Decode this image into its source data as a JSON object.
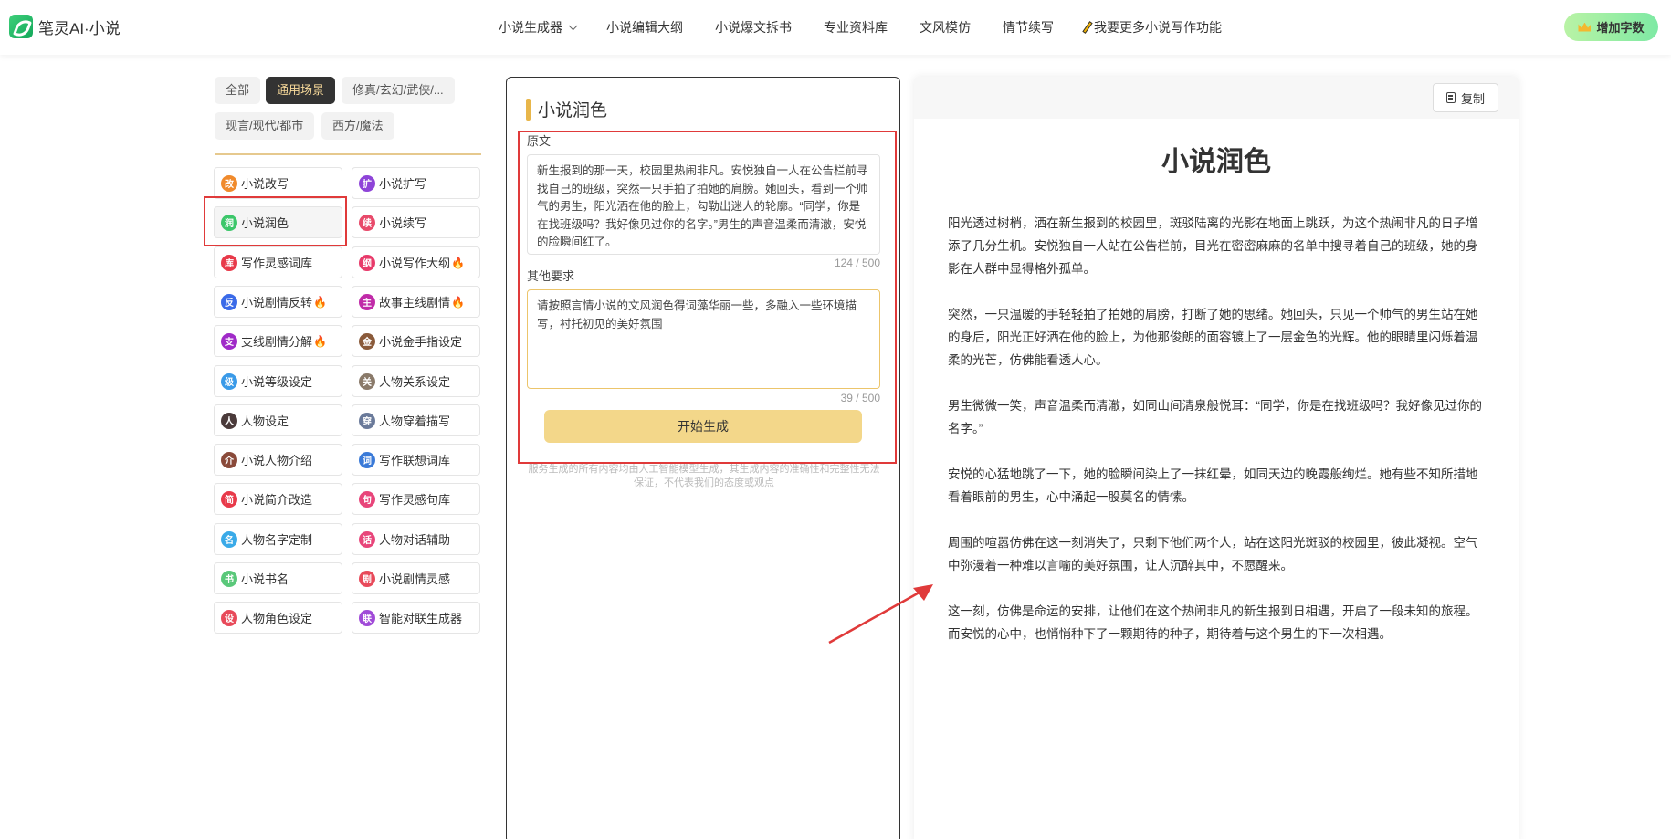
{
  "header": {
    "logo_text": "笔灵AI·小说",
    "nav": [
      {
        "label": "小说生成器",
        "has_dropdown": true
      },
      {
        "label": "小说编辑大纲"
      },
      {
        "label": "小说爆文拆书"
      },
      {
        "label": "专业资料库"
      },
      {
        "label": "文风模仿"
      },
      {
        "label": "情节续写"
      },
      {
        "label": "我要更多小说写作功能",
        "icon": "pencil-icon"
      }
    ],
    "add_words_label": "增加字数"
  },
  "left": {
    "tabs": [
      "全部",
      "通用场景",
      "修真/玄幻/武侠/...",
      "现言/现代/都市",
      "西方/魔法"
    ],
    "active_tab": "通用场景",
    "tools": [
      {
        "label": "小说改写",
        "icon_text": "改",
        "color": "#f08a2c"
      },
      {
        "label": "小说扩写",
        "icon_text": "扩",
        "color": "#8e44d8"
      },
      {
        "label": "小说润色",
        "icon_text": "润",
        "color": "#3cc76a",
        "selected": true
      },
      {
        "label": "小说续写",
        "icon_text": "续",
        "color": "#e84a6a"
      },
      {
        "label": "写作灵感词库",
        "icon_text": "库",
        "color": "#e83a4a"
      },
      {
        "label": "小说写作大纲",
        "icon_text": "纲",
        "color": "#e83a6a",
        "hot": true
      },
      {
        "label": "小说剧情反转",
        "icon_text": "反",
        "color": "#3a6ae8",
        "hot": true
      },
      {
        "label": "故事主线剧情",
        "icon_text": "主",
        "color": "#c02aa8",
        "hot": true
      },
      {
        "label": "支线剧情分解",
        "icon_text": "支",
        "color": "#a02ac8",
        "hot": true
      },
      {
        "label": "小说金手指设定",
        "icon_text": "金",
        "color": "#8a5a3a"
      },
      {
        "label": "小说等级设定",
        "icon_text": "级",
        "color": "#3a9ae8"
      },
      {
        "label": "人物关系设定",
        "icon_text": "关",
        "color": "#8a7a6a"
      },
      {
        "label": "人物设定",
        "icon_text": "人",
        "color": "#4a3a3a"
      },
      {
        "label": "人物穿着描写",
        "icon_text": "穿",
        "color": "#6a7a9a"
      },
      {
        "label": "小说人物介绍",
        "icon_text": "介",
        "color": "#8a4a3a"
      },
      {
        "label": "写作联想词库",
        "icon_text": "词",
        "color": "#3a7ad8"
      },
      {
        "label": "小说简介改造",
        "icon_text": "简",
        "color": "#e83a4a"
      },
      {
        "label": "写作灵感句库",
        "icon_text": "句",
        "color": "#e8457a"
      },
      {
        "label": "人物名字定制",
        "icon_text": "名",
        "color": "#3aaae8"
      },
      {
        "label": "人物对话辅助",
        "icon_text": "话",
        "color": "#e8457a"
      },
      {
        "label": "小说书名",
        "icon_text": "书",
        "color": "#5ac87a"
      },
      {
        "label": "小说剧情灵感",
        "icon_text": "剧",
        "color": "#e84a5a"
      },
      {
        "label": "人物角色设定",
        "icon_text": "设",
        "color": "#e84a5a"
      },
      {
        "label": "智能对联生成器",
        "icon_text": "联",
        "color": "#a04ad8"
      }
    ],
    "hot_mark": "🔥"
  },
  "middle": {
    "title": "小说润色",
    "original_label": "原文",
    "original_text": "新生报到的那一天，校园里热闹非凡。安悦独自一人在公告栏前寻找自己的班级，突然一只手拍了拍她的肩膀。她回头，看到一个帅气的男生，阳光洒在他的脸上，勾勒出迷人的轮廓。“同学，你是在找班级吗？我好像见过你的名字。”男生的声音温柔而清澈，安悦的脸瞬间红了。",
    "original_count": "124 / 500",
    "other_label": "其他要求",
    "other_text": "请按照言情小说的文风润色得词藻华丽一些，多融入一些环境描写，衬托初见的美好氛围",
    "other_count": "39 / 500",
    "generate_label": "开始生成",
    "disclaimer": "服务生成的所有内容均由人工智能模型生成，其生成内容的准确性和完整性无法保证，不代表我们的态度或观点"
  },
  "right": {
    "copy_label": "复制",
    "title": "小说润色",
    "paragraphs": [
      "阳光透过树梢，洒在新生报到的校园里，斑驳陆离的光影在地面上跳跃，为这个热闹非凡的日子增添了几分生机。安悦独自一人站在公告栏前，目光在密密麻麻的名单中搜寻着自己的班级，她的身影在人群中显得格外孤单。",
      "突然，一只温暖的手轻轻拍了拍她的肩膀，打断了她的思绪。她回头，只见一个帅气的男生站在她的身后，阳光正好洒在他的脸上，为他那俊朗的面容镀上了一层金色的光辉。他的眼睛里闪烁着温柔的光芒，仿佛能看透人心。",
      "男生微微一笑，声音温柔而清澈，如同山间清泉般悦耳：“同学，你是在找班级吗？我好像见过你的名字。”",
      "安悦的心猛地跳了一下，她的脸瞬间染上了一抹红晕，如同天边的晚霞般绚烂。她有些不知所措地看着眼前的男生，心中涌起一股莫名的情愫。",
      "周围的喧嚣仿佛在这一刻消失了，只剩下他们两个人，站在这阳光斑驳的校园里，彼此凝视。空气中弥漫着一种难以言喻的美好氛围，让人沉醉其中，不愿醒来。",
      "这一刻，仿佛是命运的安排，让他们在这个热闹非凡的新生报到日相遇，开启了一段未知的旅程。而安悦的心中，也悄悄种下了一颗期待的种子，期待着与这个男生的下一次相遇。"
    ]
  },
  "colors": {
    "accent_gold": "#f3d78a",
    "highlight_red": "#e03a3a",
    "active_tab_bg": "#333333",
    "active_tab_text": "#f7d99a"
  }
}
